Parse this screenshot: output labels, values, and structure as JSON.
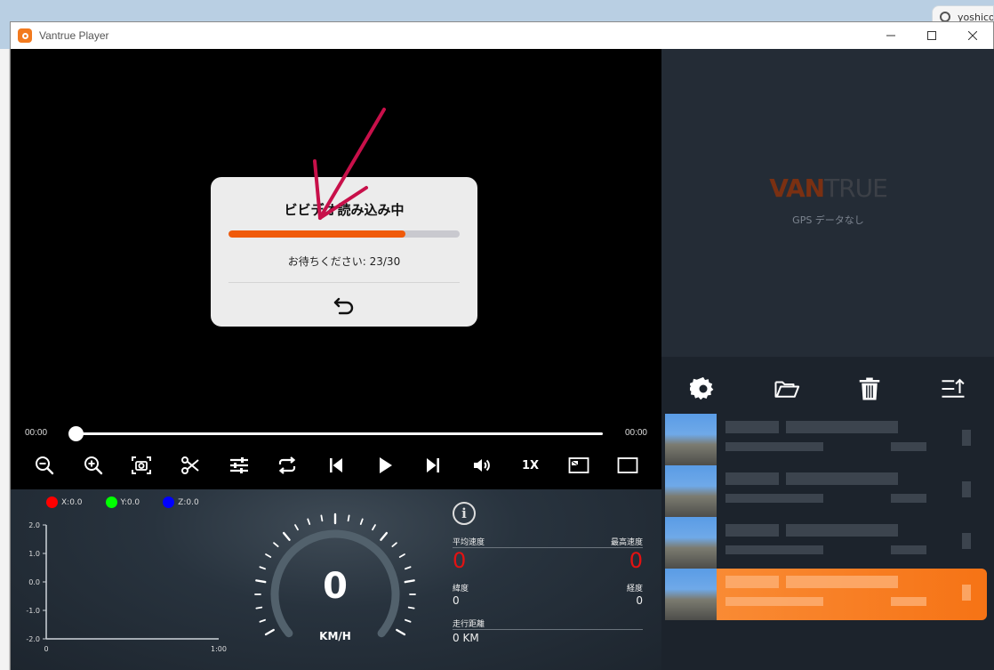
{
  "window": {
    "title": "Vantrue Player"
  },
  "background": {
    "tab_text": "yoshico"
  },
  "dialog": {
    "title": "ビビデオ読み込み中",
    "status": "お待ちください: 23/30",
    "progress": 0.7667
  },
  "timeline": {
    "current": "00:00",
    "duration": "00:00"
  },
  "controls": {
    "speed_label": "1X"
  },
  "sensor": {
    "x_label": "X:0.0",
    "y_label": "Y:0.0",
    "z_label": "Z:0.0",
    "x_color": "#ff0000",
    "y_color": "#00ff00",
    "z_color": "#0000ff"
  },
  "chart_data": {
    "type": "line",
    "series": [
      {
        "name": "X:0.0",
        "values": []
      },
      {
        "name": "Y:0.0",
        "values": []
      },
      {
        "name": "Z:0.0",
        "values": []
      }
    ],
    "yticks": [
      "2.0",
      "1.0",
      "0.0",
      "-1.0",
      "-2.0"
    ],
    "xticks": [
      "0",
      "1:00"
    ],
    "ylim": [
      -2,
      2
    ]
  },
  "speedometer": {
    "value": "0",
    "unit": "KM/H"
  },
  "trip": {
    "avg_speed_label": "平均速度",
    "max_speed_label": "最高速度",
    "avg_speed": "0",
    "max_speed": "0",
    "lat_label": "緯度",
    "lon_label": "経度",
    "lat": "0",
    "lon": "0",
    "distance_label": "走行距離",
    "distance": "0 KM"
  },
  "side": {
    "brand_a": "VAN",
    "brand_b": "TRUE",
    "no_gps": "GPS データなし"
  },
  "files": [
    {
      "active": false
    },
    {
      "active": false
    },
    {
      "active": false
    },
    {
      "active": true
    }
  ],
  "colors": {
    "accent": "#f05a0a",
    "active_item": "#f67315"
  }
}
